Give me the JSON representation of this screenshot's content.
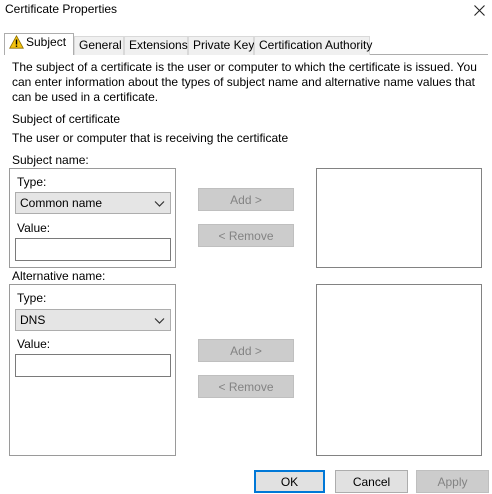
{
  "window": {
    "title": "Certificate Properties"
  },
  "tabs": [
    {
      "label": "Subject",
      "active": true,
      "icon": "warning-icon"
    },
    {
      "label": "General"
    },
    {
      "label": "Extensions"
    },
    {
      "label": "Private Key"
    },
    {
      "label": "Certification Authority"
    }
  ],
  "description": "The subject of a certificate is the user or computer to which the certificate is issued. You can enter information about the types of subject name and alternative name values that can be used in a certificate.",
  "subject_of_certificate": {
    "heading": "Subject of certificate",
    "text": "The user or computer that is receiving the certificate"
  },
  "subject_name": {
    "label": "Subject name:",
    "type_label": "Type:",
    "type_value": "Common name",
    "value_label": "Value:",
    "value": "",
    "add_label": "Add >",
    "remove_label": "< Remove"
  },
  "alternative_name": {
    "label": "Alternative name:",
    "type_label": "Type:",
    "type_value": "DNS",
    "value_label": "Value:",
    "value": "",
    "add_label": "Add >",
    "remove_label": "< Remove"
  },
  "footer": {
    "ok_label": "OK",
    "cancel_label": "Cancel",
    "apply_label": "Apply"
  },
  "colors": {
    "accent": "#0078d7",
    "disabled_button": "#cccccc",
    "warning": "#f4c20d"
  }
}
